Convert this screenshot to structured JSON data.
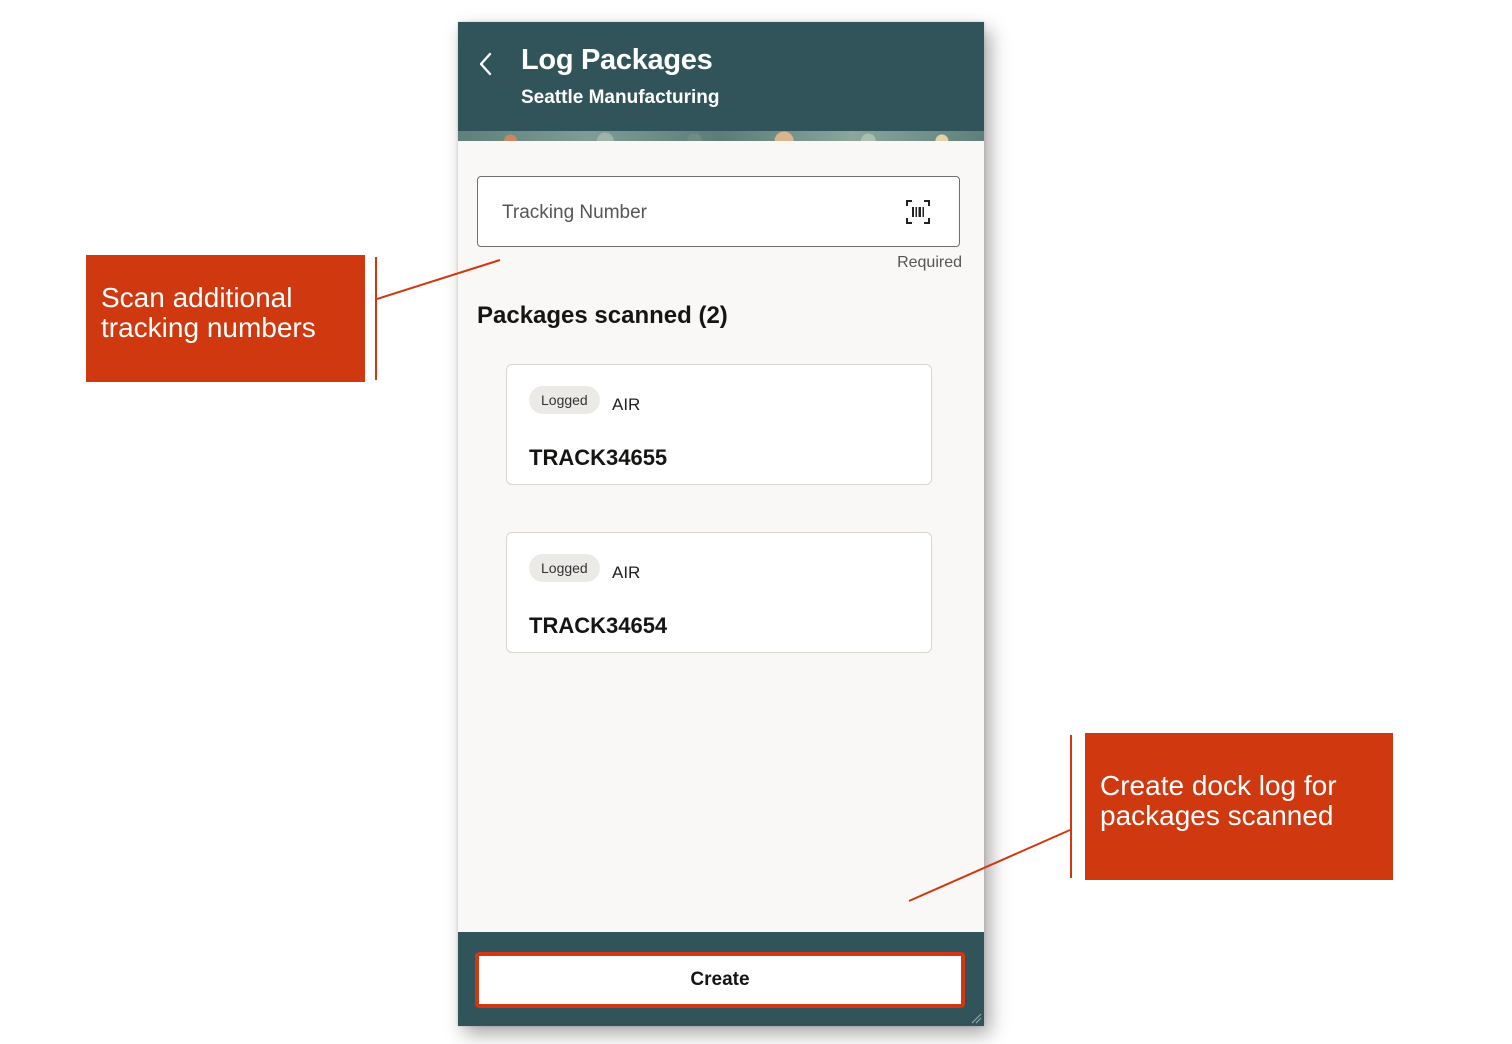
{
  "header": {
    "title": "Log Packages",
    "subtitle": "Seattle Manufacturing",
    "back_icon": "chevron-left-icon"
  },
  "tracking_field": {
    "placeholder": "Tracking Number",
    "value": "",
    "scan_icon": "barcode-scan-icon",
    "helper": "Required"
  },
  "packages": {
    "heading": "Packages scanned (2)",
    "items": [
      {
        "status": "Logged",
        "mode": "AIR",
        "tracking_number": "TRACK34655"
      },
      {
        "status": "Logged",
        "mode": "AIR",
        "tracking_number": "TRACK34654"
      }
    ]
  },
  "footer": {
    "create_label": "Create"
  },
  "callouts": {
    "scan": "Scan additional\ntracking numbers",
    "create": "Create dock log for\npackages scanned"
  },
  "colors": {
    "header_bg": "#30545a",
    "callout_bg": "#d0380f",
    "page_bg": "#f9f8f6"
  }
}
